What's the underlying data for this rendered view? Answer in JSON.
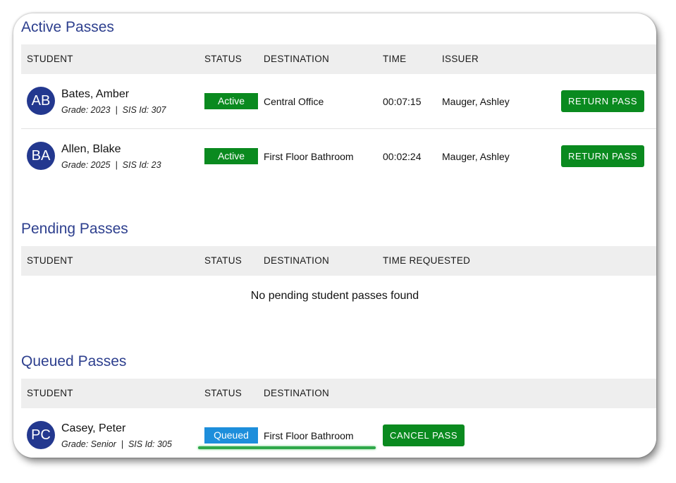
{
  "active": {
    "title": "Active Passes",
    "headers": {
      "student": "STUDENT",
      "status": "STATUS",
      "destination": "DESTINATION",
      "time": "TIME",
      "issuer": "ISSUER"
    },
    "rows": [
      {
        "initials": "AB",
        "name": "Bates, Amber",
        "meta": "Grade: 2023  |  SIS Id: 307",
        "status": "Active",
        "destination": "Central Office",
        "time": "00:07:15",
        "issuer": "Mauger, Ashley",
        "action": "RETURN PASS"
      },
      {
        "initials": "BA",
        "name": "Allen, Blake",
        "meta": "Grade: 2025  |  SIS Id: 23",
        "status": "Active",
        "destination": "First Floor Bathroom",
        "time": "00:02:24",
        "issuer": "Mauger, Ashley",
        "action": "RETURN PASS"
      }
    ]
  },
  "pending": {
    "title": "Pending Passes",
    "headers": {
      "student": "STUDENT",
      "status": "STATUS",
      "destination": "DESTINATION",
      "time_requested": "TIME REQUESTED"
    },
    "empty_message": "No pending student passes found"
  },
  "queued": {
    "title": "Queued Passes",
    "headers": {
      "student": "STUDENT",
      "status": "STATUS",
      "destination": "DESTINATION"
    },
    "rows": [
      {
        "initials": "PC",
        "name": "Casey, Peter",
        "meta": "Grade: Senior  |  SIS Id: 305",
        "status": "Queued",
        "destination": "First Floor Bathroom",
        "action": "CANCEL PASS"
      }
    ]
  },
  "colors": {
    "accent": "#23388f",
    "title": "#2d3f8e",
    "active": "#0a8a1f",
    "queued": "#1d8edb",
    "highlight": "#2fa84a"
  }
}
